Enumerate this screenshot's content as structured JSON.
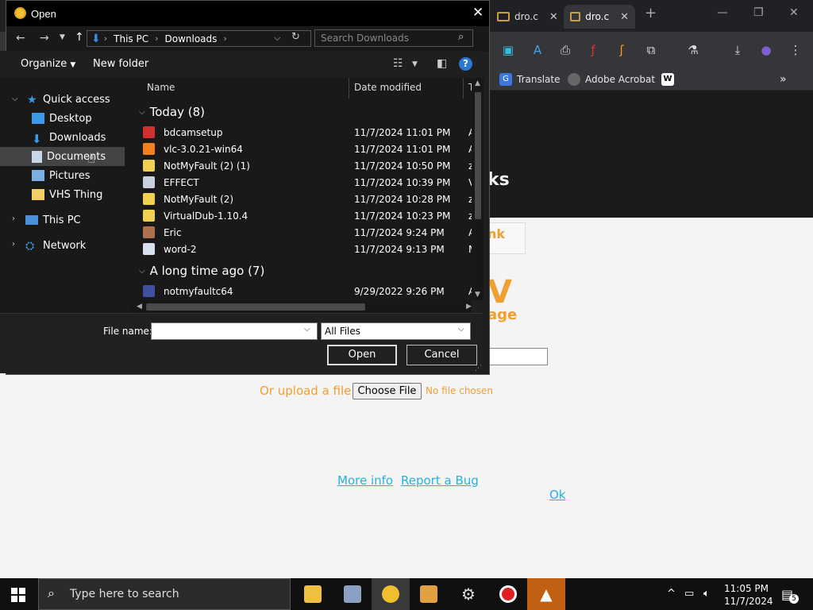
{
  "browser": {
    "tabs": [
      {
        "label": "dro.c"
      },
      {
        "label": "dro.c"
      }
    ],
    "new_tab_icon": "plus-icon",
    "bookmarks": [
      {
        "label": "Translate",
        "color": "#3a78e0"
      },
      {
        "label": "Adobe Acrobat",
        "color": "#888888"
      },
      {
        "label": "W",
        "color": "#ffffff"
      }
    ],
    "page": {
      "dark_heading_fragment": "ks",
      "link_fragment": "nk",
      "big_fragment": "V",
      "sub_fragment": "age",
      "upload_label": "Or upload a file",
      "choose_file": "Choose File",
      "no_file": "No file chosen",
      "more_info": "More info",
      "report_bug": "Report a Bug",
      "ok": "Ok"
    }
  },
  "dialog": {
    "title": "Open",
    "breadcrumb": [
      "This PC",
      "Downloads"
    ],
    "search_placeholder": "Search Downloads",
    "toolbar": {
      "organize": "Organize",
      "new_folder": "New folder",
      "help": "?"
    },
    "nav": {
      "quick_access": "Quick access",
      "items": [
        {
          "label": "Desktop",
          "color": "#3a9ae8"
        },
        {
          "label": "Downloads",
          "color": "#3a9ae8"
        },
        {
          "label": "Documents",
          "color": "#c8d8e8"
        },
        {
          "label": "Pictures",
          "color": "#7ab0e0"
        },
        {
          "label": "VHS Thing",
          "color": "#f0d060"
        }
      ],
      "this_pc": "This PC",
      "network": "Network"
    },
    "columns": {
      "name": "Name",
      "date": "Date modified",
      "type": "Ty"
    },
    "groups": [
      {
        "label": "Today (8)",
        "files": [
          {
            "name": "bdcamsetup",
            "date": "11/7/2024 11:01 PM",
            "type": "Ap",
            "color": "#d03030"
          },
          {
            "name": "vlc-3.0.21-win64",
            "date": "11/7/2024 11:01 PM",
            "type": "Ap",
            "color": "#f08020"
          },
          {
            "name": "NotMyFault (2) (1)",
            "date": "11/7/2024 10:50 PM",
            "type": "zi",
            "color": "#f0d050"
          },
          {
            "name": "EFFECT",
            "date": "11/7/2024 10:39 PM",
            "type": "Vi",
            "color": "#c8d0e0"
          },
          {
            "name": "NotMyFault (2)",
            "date": "11/7/2024 10:28 PM",
            "type": "zi",
            "color": "#f0d050"
          },
          {
            "name": "VirtualDub-1.10.4",
            "date": "11/7/2024 10:23 PM",
            "type": "zi",
            "color": "#f0d050"
          },
          {
            "name": "Eric",
            "date": "11/7/2024 9:24 PM",
            "type": "Ap",
            "color": "#b07050"
          },
          {
            "name": "word-2",
            "date": "11/7/2024 9:13 PM",
            "type": "M",
            "color": "#d8e0f0"
          }
        ]
      },
      {
        "label": "A long time ago (7)",
        "files": [
          {
            "name": "notmyfaultc64",
            "date": "9/29/2022 9:26 PM",
            "type": "Ap",
            "color": "#4050a0"
          }
        ]
      }
    ],
    "file_name_label": "File name:",
    "file_name_value": "",
    "file_type": "All Files",
    "open": "Open",
    "cancel": "Cancel"
  },
  "taskbar": {
    "search_placeholder": "Type here to search",
    "time": "11:05 PM",
    "date": "11/7/2024",
    "notifications": "5"
  }
}
